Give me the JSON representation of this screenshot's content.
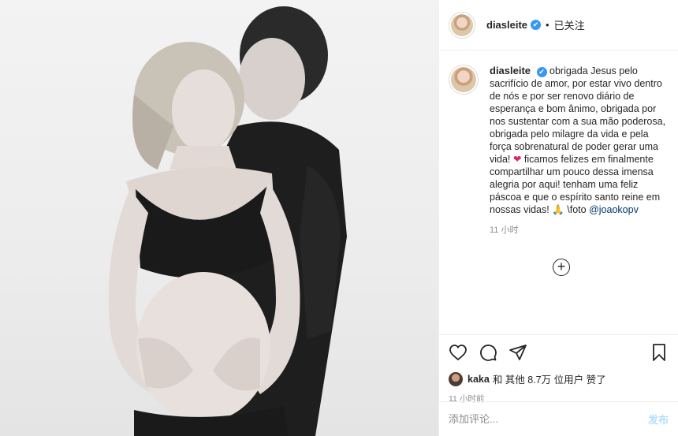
{
  "header": {
    "username": "diasleite",
    "verified_badge": "✔",
    "separator": "•",
    "follow_status": "已关注"
  },
  "caption": {
    "username": "diasleite",
    "text_before_heart": "obrigada Jesus pelo sacrifício de amor, por estar vivo dentro de nós e por ser renovo diário de esperança e bom ânimo, obrigada por nos sustentar com a sua mão poderosa, obrigada pelo milagre da vida e pela força sobrenatural de poder gerar uma vida!",
    "heart": "❤",
    "text_after_heart": "ficamos felizes em finalmente compartilhar um pouco dessa imensa alegria por aqui! tenham uma feliz páscoa e que o espírito santo reine em nossas vidas!",
    "prayer_emoji": "🙏",
    "photo_credit": "\\foto",
    "mention": "@joaokopv",
    "time": "11 小时"
  },
  "load_more": "+",
  "actions": {
    "icons": [
      "heart-icon",
      "comment-icon",
      "share-icon",
      "bookmark-icon"
    ]
  },
  "likes": {
    "liker": "kaka",
    "text": "和 其他 8.7万 位用户 赞了"
  },
  "post_time": "11 小时前",
  "comment_input": {
    "placeholder": "添加评论...",
    "submit_label": "发布"
  }
}
